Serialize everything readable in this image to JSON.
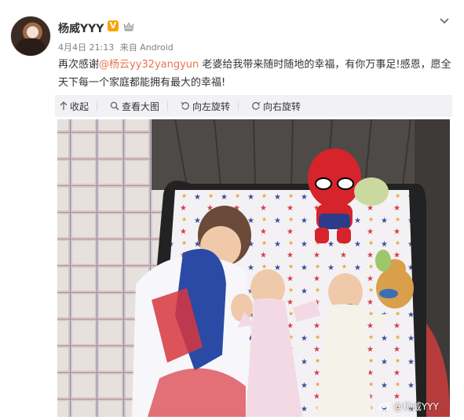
{
  "post": {
    "username": "杨威YYY",
    "verified_badge": "V",
    "timestamp": "4月4日 21:13",
    "source": "来自 Android",
    "text_before_mention": "再次感谢",
    "mention": "@杨云yy32yangyun",
    "text_after_mention": " 老婆给我带来随时随地的幸福，有你万事足!感恩，愿全天下每一个家庭都能拥有最大的幸福!"
  },
  "toolbar": {
    "collapse_label": "收起",
    "view_large_label": "查看大图",
    "rotate_left_label": "向左旋转",
    "rotate_right_label": "向右旋转"
  },
  "photo": {
    "watermark": "@杨威YYY"
  },
  "colors": {
    "accent_mention": "#eb7350",
    "toolbar_bg": "#f2f2f5",
    "verified_orange": "#f7a400"
  },
  "icons": [
    "avatar",
    "verified-icon",
    "crown-icon",
    "chevron-down-icon",
    "collapse-icon",
    "zoom-icon",
    "rotate-left-icon",
    "rotate-right-icon",
    "weibo-icon"
  ]
}
